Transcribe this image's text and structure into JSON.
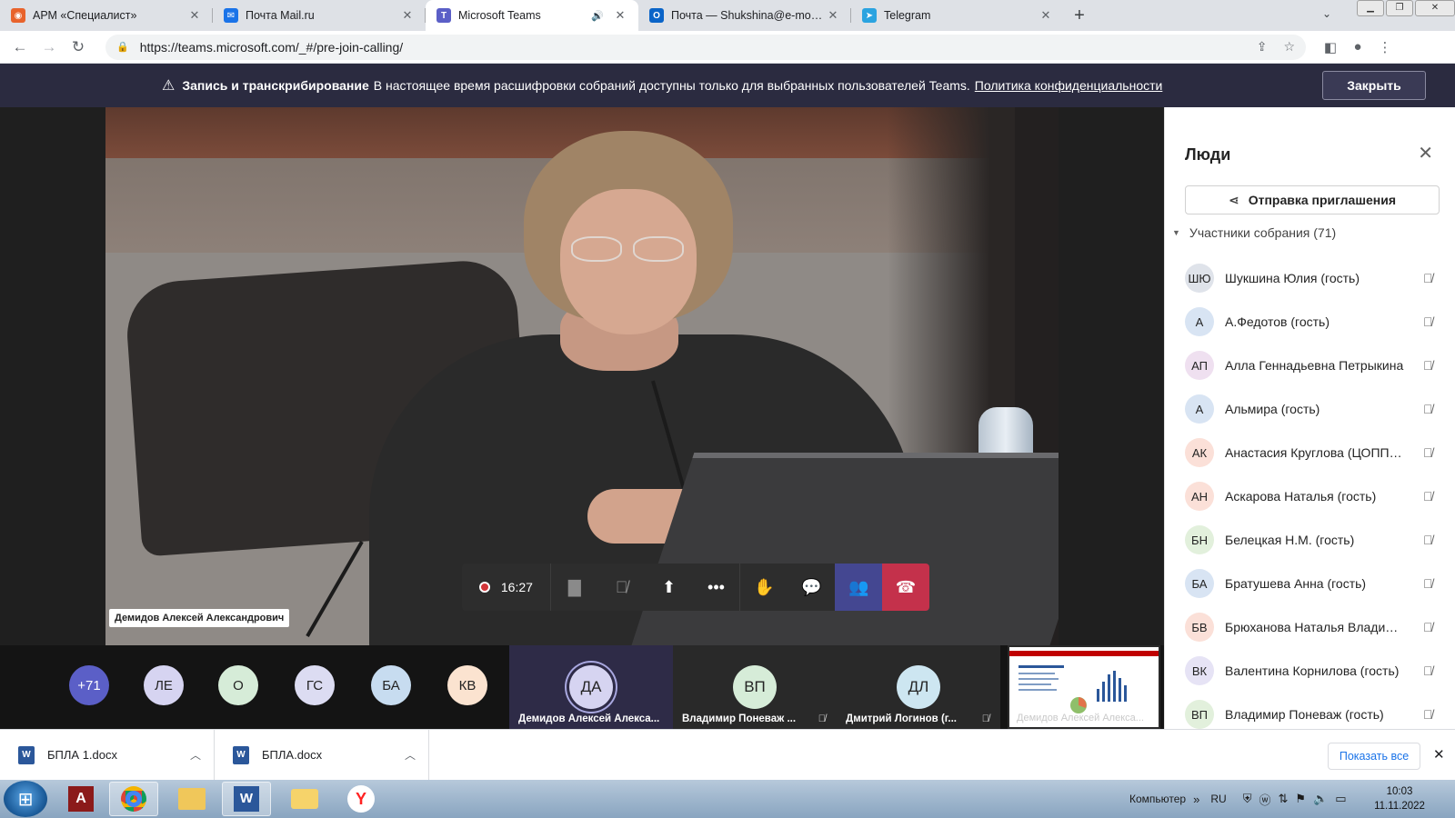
{
  "browser": {
    "tabs": [
      {
        "title": "АРМ «Специалист»",
        "favicon_color": "#e8632c",
        "favicon": "◉"
      },
      {
        "title": "Почта Mail.ru",
        "favicon_color": "#1a73e8",
        "favicon": "✉"
      },
      {
        "title": "Microsoft Teams",
        "favicon_color": "#5b5fc7",
        "favicon": "T",
        "active": true
      },
      {
        "title": "Почта — Shukshina@e-mordovia",
        "favicon_color": "#0a64c8",
        "favicon": "O"
      },
      {
        "title": "Telegram",
        "favicon_color": "#2aa3e0",
        "favicon": "➤"
      }
    ],
    "url": "https://teams.microsoft.com/_#/pre-join-calling/"
  },
  "banner": {
    "bold": "Запись и транскрибирование",
    "text": "В настоящее время расшифровки собраний доступны только для выбранных пользователей Teams.",
    "link": "Политика конфиденциальности",
    "close_label": "Закрыть"
  },
  "stage": {
    "speaker_name": "Демидов Алексей Александрович",
    "timer": "16:27"
  },
  "strip": {
    "overflow": "+71",
    "avatars": [
      {
        "initials": "ЛЕ",
        "color": "#d6d4f1"
      },
      {
        "initials": "О",
        "color": "#d6ecd8"
      },
      {
        "initials": "ГС",
        "color": "#dcdcf2"
      },
      {
        "initials": "БА",
        "color": "#c7dcf0"
      },
      {
        "initials": "КВ",
        "color": "#fbe3d0"
      }
    ],
    "tiles": [
      {
        "initials": "ДА",
        "name": "Демидов Алексей Алекса...",
        "color": "#d6d4f1"
      },
      {
        "initials": "ВП",
        "name": "Владимир Поневаж ...",
        "color": "#d6ecd8"
      },
      {
        "initials": "ДЛ",
        "name": "Дмитрий Логинов (г...",
        "color": "#cde6f1"
      }
    ],
    "screen_share_name": "Демидов Алексей Алекса..."
  },
  "panel": {
    "title": "Люди",
    "invite_label": "Отправка приглашения",
    "section_label": "Участники собрания (71)",
    "participants": [
      {
        "initials": "ШЮ",
        "name": "Шукшина Юлия (гость)",
        "color": "#dfe3ea"
      },
      {
        "initials": "А",
        "name": "А.Федотов (гость)",
        "color": "#d8e4f3"
      },
      {
        "initials": "АП",
        "name": "Алла Геннадьевна Петрыкина",
        "color": "#efe0f0"
      },
      {
        "initials": "А",
        "name": "Альмира (гость)",
        "color": "#d8e4f3"
      },
      {
        "initials": "АК",
        "name": "Анастасия Круглова (ЦОПП гость)",
        "color": "#fbe0d8"
      },
      {
        "initials": "АН",
        "name": "Аскарова Наталья (гость)",
        "color": "#fbe0d8"
      },
      {
        "initials": "БН",
        "name": "Белецкая Н.М. (гость)",
        "color": "#e2f0dc"
      },
      {
        "initials": "БА",
        "name": "Братушева Анна (гость)",
        "color": "#d8e4f3"
      },
      {
        "initials": "БВ",
        "name": "Брюханова Наталья Владимировна",
        "color": "#fbe0d8"
      },
      {
        "initials": "ВК",
        "name": "Валентина Корнилова (гость)",
        "color": "#e6e3f5"
      },
      {
        "initials": "ВП",
        "name": "Владимир Поневаж (гость)",
        "color": "#e2f0dc"
      }
    ]
  },
  "downloads": {
    "items": [
      {
        "name": "БПЛА 1.docx"
      },
      {
        "name": "БПЛА.docx"
      }
    ],
    "show_all_label": "Показать все"
  },
  "taskbar": {
    "computer_label": "Компьютер",
    "lang": "RU",
    "time": "10:03",
    "date": "11.11.2022"
  }
}
